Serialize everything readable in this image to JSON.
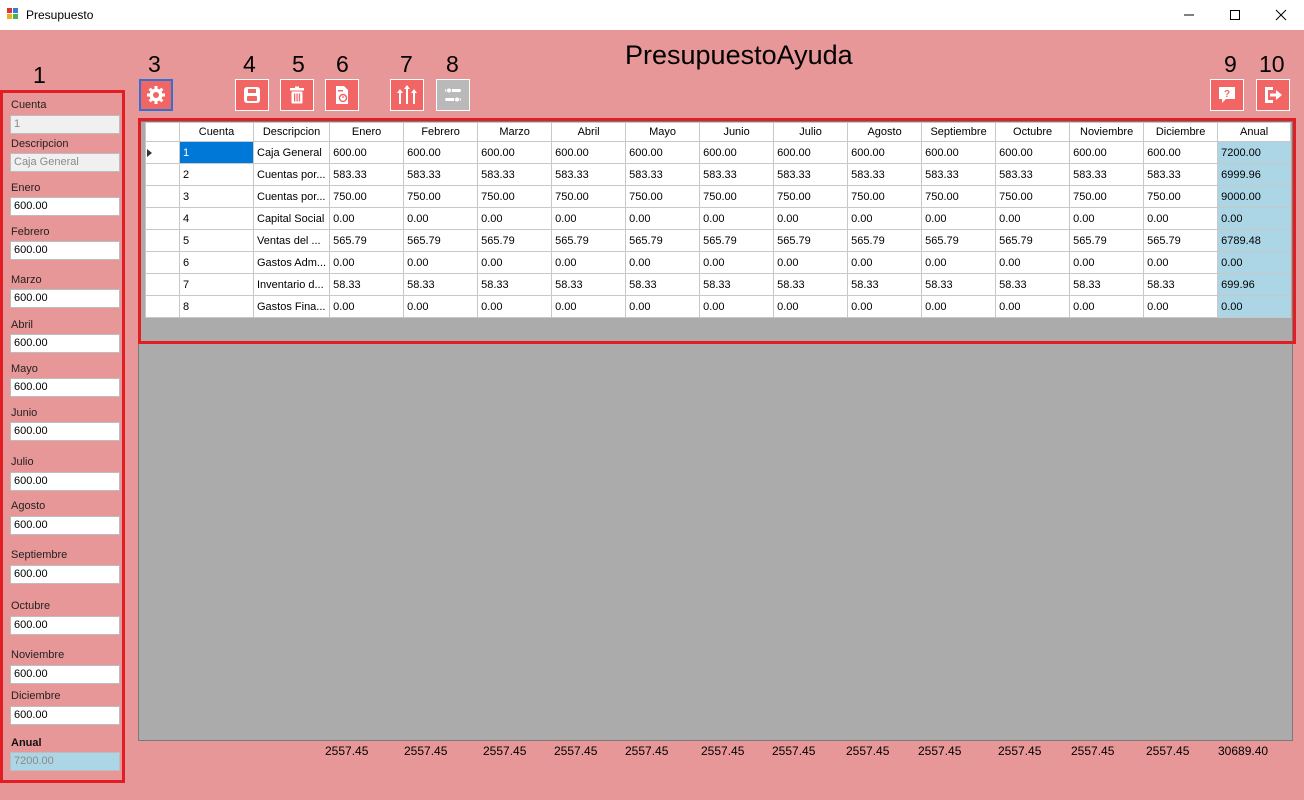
{
  "window": {
    "title": "Presupuesto"
  },
  "form_title": "PresupuestoAyuda",
  "annotation_numbers": [
    "1",
    "2",
    "3",
    "4",
    "5",
    "6",
    "7",
    "8",
    "9",
    "10"
  ],
  "toolbar": {
    "buttons": [
      {
        "icon": "gear-icon",
        "state": "selected"
      },
      {
        "icon": "save-icon",
        "state": "enabled"
      },
      {
        "icon": "trash-icon",
        "state": "enabled"
      },
      {
        "icon": "report-icon",
        "state": "enabled"
      },
      {
        "icon": "sliders-icon",
        "state": "enabled"
      },
      {
        "icon": "toggle-settings-icon",
        "state": "disabled"
      },
      {
        "icon": "help-icon",
        "state": "enabled"
      },
      {
        "icon": "exit-icon",
        "state": "enabled"
      }
    ]
  },
  "side_panel": {
    "cuenta_label": "Cuenta",
    "cuenta_value": "1",
    "descripcion_label": "Descripcion",
    "descripcion_value": "Caja General",
    "months": [
      {
        "label": "Enero",
        "value": "600.00"
      },
      {
        "label": "Febrero",
        "value": "600.00"
      },
      {
        "label": "Marzo",
        "value": "600.00"
      },
      {
        "label": "Abril",
        "value": "600.00"
      },
      {
        "label": "Mayo",
        "value": "600.00"
      },
      {
        "label": "Junio",
        "value": "600.00"
      },
      {
        "label": "Julio",
        "value": "600.00"
      },
      {
        "label": "Agosto",
        "value": "600.00"
      },
      {
        "label": "Septiembre",
        "value": "600.00"
      },
      {
        "label": "Octubre",
        "value": "600.00"
      },
      {
        "label": "Noviembre",
        "value": "600.00"
      },
      {
        "label": "Diciembre",
        "value": "600.00"
      }
    ],
    "anual_label": "Anual",
    "anual_value": "7200.00"
  },
  "grid": {
    "columns": [
      "Cuenta",
      "Descripcion",
      "Enero",
      "Febrero",
      "Marzo",
      "Abril",
      "Mayo",
      "Junio",
      "Julio",
      "Agosto",
      "Septiembre",
      "Octubre",
      "Noviembre",
      "Diciembre",
      "Anual"
    ],
    "rows": [
      [
        "1",
        "Caja General",
        "600.00",
        "600.00",
        "600.00",
        "600.00",
        "600.00",
        "600.00",
        "600.00",
        "600.00",
        "600.00",
        "600.00",
        "600.00",
        "600.00",
        "7200.00"
      ],
      [
        "2",
        "Cuentas por...",
        "583.33",
        "583.33",
        "583.33",
        "583.33",
        "583.33",
        "583.33",
        "583.33",
        "583.33",
        "583.33",
        "583.33",
        "583.33",
        "583.33",
        "6999.96"
      ],
      [
        "3",
        "Cuentas por...",
        "750.00",
        "750.00",
        "750.00",
        "750.00",
        "750.00",
        "750.00",
        "750.00",
        "750.00",
        "750.00",
        "750.00",
        "750.00",
        "750.00",
        "9000.00"
      ],
      [
        "4",
        "Capital Social",
        "0.00",
        "0.00",
        "0.00",
        "0.00",
        "0.00",
        "0.00",
        "0.00",
        "0.00",
        "0.00",
        "0.00",
        "0.00",
        "0.00",
        "0.00"
      ],
      [
        "5",
        "Ventas del ...",
        "565.79",
        "565.79",
        "565.79",
        "565.79",
        "565.79",
        "565.79",
        "565.79",
        "565.79",
        "565.79",
        "565.79",
        "565.79",
        "565.79",
        "6789.48"
      ],
      [
        "6",
        "Gastos Adm...",
        "0.00",
        "0.00",
        "0.00",
        "0.00",
        "0.00",
        "0.00",
        "0.00",
        "0.00",
        "0.00",
        "0.00",
        "0.00",
        "0.00",
        "0.00"
      ],
      [
        "7",
        "Inventario d...",
        "58.33",
        "58.33",
        "58.33",
        "58.33",
        "58.33",
        "58.33",
        "58.33",
        "58.33",
        "58.33",
        "58.33",
        "58.33",
        "58.33",
        "699.96"
      ],
      [
        "8",
        "Gastos Fina...",
        "0.00",
        "0.00",
        "0.00",
        "0.00",
        "0.00",
        "0.00",
        "0.00",
        "0.00",
        "0.00",
        "0.00",
        "0.00",
        "0.00",
        "0.00"
      ]
    ],
    "selected_row": 0,
    "selected_col": 0
  },
  "totals": [
    "2557.45",
    "2557.45",
    "2557.45",
    "2557.45",
    "2557.45",
    "2557.45",
    "2557.45",
    "2557.45",
    "2557.45",
    "2557.45",
    "2557.45",
    "2557.45",
    "30689.40"
  ],
  "colors": {
    "background": "#e89798",
    "toolbar_button": "#f26565",
    "highlight_box": "#e31d24",
    "anual_cell": "#acd6e6",
    "selection": "#0078d7",
    "grid_empty": "#ababab"
  }
}
